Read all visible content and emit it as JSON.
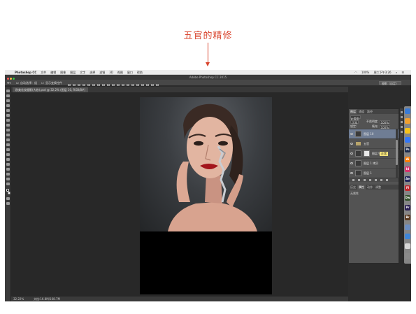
{
  "annotation": {
    "caption": "五官的精修"
  },
  "menubar": {
    "apple_glyph": "",
    "menus": [
      {
        "label": "Photoshop CC",
        "bold": true
      },
      {
        "label": "文件"
      },
      {
        "label": "编辑"
      },
      {
        "label": "图像"
      },
      {
        "label": "图层"
      },
      {
        "label": "文字"
      },
      {
        "label": "选择"
      },
      {
        "label": "滤镜"
      },
      {
        "label": "3D"
      },
      {
        "label": "视图"
      },
      {
        "label": "窗口"
      },
      {
        "label": "帮助"
      }
    ],
    "battery": "100%",
    "clock": "周六下午3:26"
  },
  "window": {
    "title": "Adobe Photoshop CC 2015"
  },
  "options_bar": {
    "auto_select_label": "自动选择：",
    "auto_select_value": "组",
    "show_transform_label": "显示变换控件",
    "workspace": "摄影（自定）"
  },
  "document": {
    "tab_label": "欧美化妆摄影(大修).psd @ 32.2% (图层 10, RGB/8#)",
    "zoom": "32.22%",
    "doc_info": "文档:16.8M/168.7M"
  },
  "layers_panel": {
    "tabs": [
      {
        "label": "图层",
        "active": true
      },
      {
        "label": "通道"
      },
      {
        "label": "路径"
      }
    ],
    "filter_label": "ρ 类型",
    "blend_mode": "正常",
    "opacity_label": "不透明度:",
    "opacity_value": "100%",
    "lock_label": "锁定:",
    "fill_label": "填充:",
    "fill_value": "100%",
    "layers": [
      {
        "name": "图层 10",
        "selected": true,
        "kind": "pixel"
      },
      {
        "name": "五官",
        "selected": false,
        "kind": "group"
      },
      {
        "name": "图层 9",
        "selected": false,
        "kind": "masked",
        "chip": "正常"
      },
      {
        "name": "图层 1 拷贝",
        "selected": false,
        "kind": "pixel"
      },
      {
        "name": "图层 1",
        "selected": false,
        "kind": "pixel"
      }
    ]
  },
  "lower_panel": {
    "tabs": [
      {
        "label": "历史"
      },
      {
        "label": "属性",
        "active": true
      },
      {
        "label": "动作"
      },
      {
        "label": "调整"
      }
    ],
    "note": "无属性"
  },
  "dock": {
    "apps": [
      {
        "label": "",
        "color": "#3a7bd5"
      },
      {
        "label": "",
        "color": "#f0a030"
      },
      {
        "label": "",
        "color": "#f5c21b"
      },
      {
        "label": "",
        "color": "#3478f6"
      },
      {
        "label": "Ps",
        "color": "#1b2a4b"
      },
      {
        "label": "Ai",
        "color": "#ff7c00"
      },
      {
        "label": "Id",
        "color": "#d8336d"
      },
      {
        "label": "Ae",
        "color": "#23275c"
      },
      {
        "label": "Fl",
        "color": "#c1272d"
      },
      {
        "label": "Dw",
        "color": "#35522c"
      },
      {
        "label": "Pr",
        "color": "#2a1e52"
      },
      {
        "label": "Br",
        "color": "#5b3a20"
      },
      {
        "label": "",
        "color": "#6c8ec2"
      },
      {
        "label": "",
        "color": "#3f86d8"
      },
      {
        "label": "",
        "color": "#d8d8d8"
      },
      {
        "label": "",
        "color": "#8a8a8a"
      }
    ]
  }
}
